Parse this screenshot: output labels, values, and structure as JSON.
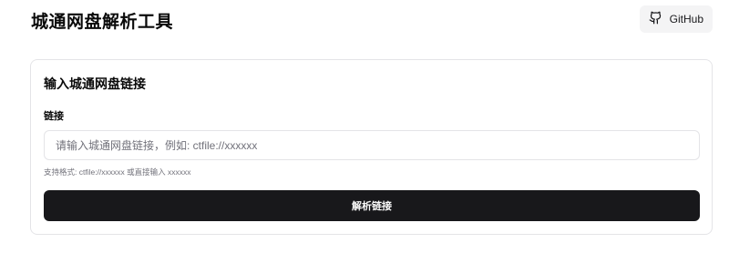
{
  "header": {
    "title": "城通网盘解析工具",
    "github_label": "GitHub",
    "github_icon": "github-icon"
  },
  "card": {
    "title": "输入城通网盘链接",
    "field_label": "链接",
    "input_value": "",
    "input_placeholder": "请输入城通网盘链接，例如: ctfile://xxxxxx",
    "hint": "支持格式: ctfile://xxxxxx 或直接输入 xxxxxx",
    "submit_label": "解析链接"
  },
  "colors": {
    "primary_button": "#18181b",
    "border": "#e4e4e7",
    "muted_text": "#71717a"
  }
}
